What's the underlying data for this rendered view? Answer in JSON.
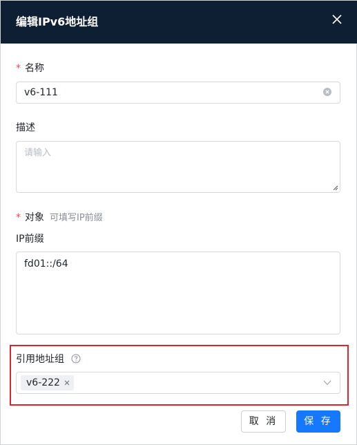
{
  "dialog": {
    "title": "编辑IPv6地址组"
  },
  "form": {
    "name": {
      "required_mark": "*",
      "label": "名称",
      "value": "v6-111"
    },
    "description": {
      "label": "描述",
      "placeholder": "请输入",
      "value": ""
    },
    "object": {
      "required_mark": "*",
      "label": "对象",
      "hint": "可填写IP前缀"
    },
    "ip_prefix": {
      "label": "IP前缀",
      "value": "fd01::/64"
    },
    "ref_group": {
      "label": "引用地址组",
      "selected_tags": [
        "v6-222"
      ]
    }
  },
  "footer": {
    "cancel_label": "取 消",
    "save_label": "保 存"
  },
  "colors": {
    "header_bg": "#0f1f33",
    "primary": "#1677ff",
    "required": "#e34d59",
    "highlight_border": "#e0242c"
  }
}
